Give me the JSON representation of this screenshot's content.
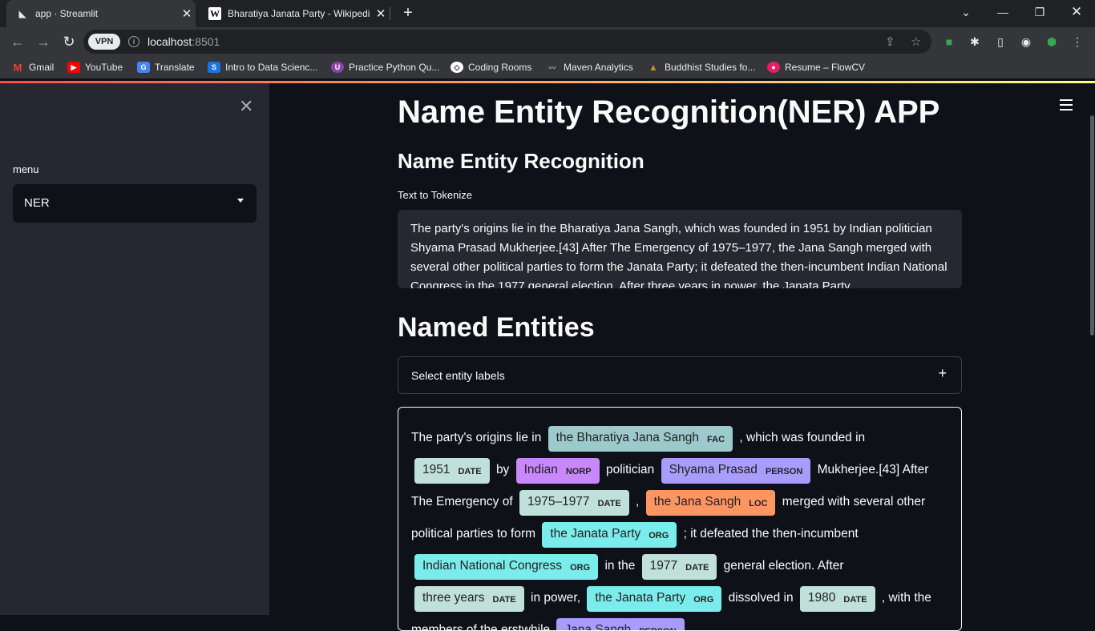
{
  "browser": {
    "tabs": [
      {
        "title": "app · Streamlit",
        "active": true
      },
      {
        "title": "Bharatiya Janata Party - Wikipedi",
        "active": false
      }
    ],
    "vpn_label": "VPN",
    "url_host": "localhost",
    "url_port": ":8501",
    "bookmarks": [
      {
        "label": "Gmail",
        "color": "#ea4335",
        "icon": "gmail-icon"
      },
      {
        "label": "YouTube",
        "color": "#ff0000",
        "icon": "youtube-icon"
      },
      {
        "label": "Translate",
        "color": "#4285f4",
        "icon": "translate-icon"
      },
      {
        "label": "Intro to Data Scienc...",
        "color": "#1a73e8",
        "icon": "s-icon"
      },
      {
        "label": "Practice Python Qu...",
        "color": "#8e44ad",
        "icon": "python-icon"
      },
      {
        "label": "Coding Rooms",
        "color": "#ffffff",
        "icon": "coding-rooms-icon"
      },
      {
        "label": "Maven Analytics",
        "color": "#9aa0a6",
        "icon": "maven-icon"
      },
      {
        "label": "Buddhist Studies fo...",
        "color": "#c28b2c",
        "icon": "buddha-icon"
      },
      {
        "label": "Resume – FlowCV",
        "color": "#e91e63",
        "icon": "flowcv-icon"
      }
    ]
  },
  "sidebar": {
    "menu_label": "menu",
    "selected": "NER"
  },
  "main": {
    "title": "Name Entity Recognition(NER) APP",
    "subtitle": "Name Entity Recognition",
    "text_label": "Text to Tokenize",
    "text_value": "The party's origins lie in the Bharatiya Jana Sangh, which was founded in 1951 by Indian politician Shyama Prasad Mukherjee.[43] After The Emergency of 1975–1977, the Jana Sangh merged with several other political parties to form the Janata Party; it defeated the then-incumbent Indian National Congress in the 1977 general election. After three years in power, the Janata Party",
    "named_entities_title": "Named Entities",
    "expander_label": "Select entity labels",
    "entities": [
      {
        "t": "The party's origins lie in"
      },
      {
        "e": "the Bharatiya Jana Sangh",
        "l": "FAC"
      },
      {
        "t": ", which was founded in"
      },
      {
        "e": "1951",
        "l": "DATE"
      },
      {
        "t": "by"
      },
      {
        "e": "Indian",
        "l": "NORP"
      },
      {
        "t": "politician"
      },
      {
        "e": "Shyama Prasad",
        "l": "PERSON"
      },
      {
        "t": "Mukherjee.[43] After The Emergency of"
      },
      {
        "e": "1975–1977",
        "l": "DATE"
      },
      {
        "t": ","
      },
      {
        "e": "the Jana Sangh",
        "l": "LOC"
      },
      {
        "t": "merged with several other political parties to form"
      },
      {
        "e": "the Janata Party",
        "l": "ORG"
      },
      {
        "t": "; it defeated the then-incumbent"
      },
      {
        "e": "Indian National Congress",
        "l": "ORG"
      },
      {
        "t": "in the"
      },
      {
        "e": "1977",
        "l": "DATE"
      },
      {
        "t": "general election. After"
      },
      {
        "e": "three years",
        "l": "DATE"
      },
      {
        "t": "in power,"
      },
      {
        "e": "the Janata Party",
        "l": "ORG"
      },
      {
        "t": "dissolved in"
      },
      {
        "e": "1980",
        "l": "DATE"
      },
      {
        "t": ", with the members of the erstwhile"
      },
      {
        "e": "Jana Sangh",
        "l": "PERSON"
      }
    ]
  }
}
